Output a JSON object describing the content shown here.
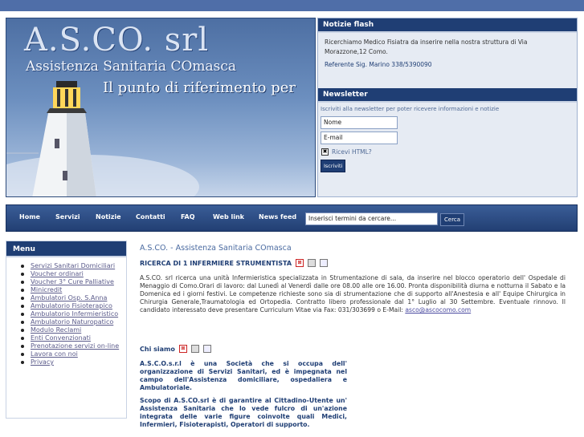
{
  "header": {
    "logo_text": "A.S.CO. srl",
    "logo_subtitle": "Assistenza Sanitaria COmasca",
    "tagline": "Il punto di riferimento per"
  },
  "flash": {
    "title": "Notizie flash",
    "text": "Ricerchiamo Medico Fisiatra da inserire nella nostra struttura di Via Morazzone,12 Como.",
    "reference": "Referente Sig. Marino 338/5390090"
  },
  "newsletter": {
    "title": "Newsletter",
    "description": "Iscriviti alla newsletter per poter ricevere informazioni e notizie",
    "name_value": "Nome",
    "email_value": "E-mail",
    "html_label": "Ricevi HTML?",
    "checkbox_mark": "✖",
    "subscribe_label": "Iscriviti"
  },
  "nav": {
    "items": [
      "Home",
      "Servizi",
      "Notizie",
      "Contatti",
      "FAQ",
      "Web link",
      "News feed"
    ],
    "search_placeholder": "Inserisci termini da cercare...",
    "search_button": "Cerca"
  },
  "sidebar": {
    "title": "Menu",
    "items": [
      "Servizi Sanitari Domiciliari",
      "Voucher ordinari",
      "Voucher 3° Cure Palliative",
      "Minicredit",
      "Ambulatori Osp. S.Anna",
      "Ambulatorio Fisioterapico",
      "Ambulatorio Infermieristico",
      "Ambulatorio Naturopatico",
      "Modulo Reclami",
      "Enti Convenzionati",
      "Prenotazione servizi on-line",
      "Lavora con noi",
      "Privacy"
    ]
  },
  "content": {
    "site_title": "A.S.CO. - Assistenza Sanitaria COmasca",
    "article_title": "RICERCA DI 1 INFERMIERE STRUMENTISTA",
    "article_body": "A.S.CO. srl ricerca una unità Infermieristica specializzata in Strumentazione di sala, da inserire nel blocco operatorio dell' Ospedale di Menaggio di Como.Orari di lavoro: dal Lunedì al Venerdì dalle ore 08.00 alle ore 16.00. Pronta disponibilità diurna e notturna il Sabato e la Domenica ed i giorni festivi. Le competenze richieste sono sia di strumentazione che di supporto all'Anestesia e all' Equipe Chirurgica in Chirurgia Generale,Traumatologia ed Ortopedia. Contratto libero professionale dal 1° Luglio al 30 Settembre. Eventuale rinnovo. Il candidato interessato deve presentare Curriculum Vitae via Fax: 031/303699 o E-Mail: ",
    "article_email": "asco@ascocomo.com",
    "chisiamo_title": "Chi siamo",
    "chisiamo_p1": "A.S.C.O.s.r.l è una Società che si occupa dell' organizzazione di Servizi Sanitari, ed è impegnata nel campo dell'Assistenza domiciliare, ospedaliera e Ambulatoriale.",
    "chisiamo_p2": "Scopo di A.S.CO.srl è di garantire al Cittadino-Utente un' Assistenza Sanitaria che lo vede fulcro di un'azione integrata delle varie figure coinvolte quali Medici, Infermieri, Fisioterapisti, Operatori di supporto."
  },
  "icons": {
    "pdf": "pdf-icon",
    "print": "print-icon",
    "email": "email-icon"
  },
  "colors": {
    "accent": "#1f3e74",
    "nav_bg": "#2d4e87"
  }
}
